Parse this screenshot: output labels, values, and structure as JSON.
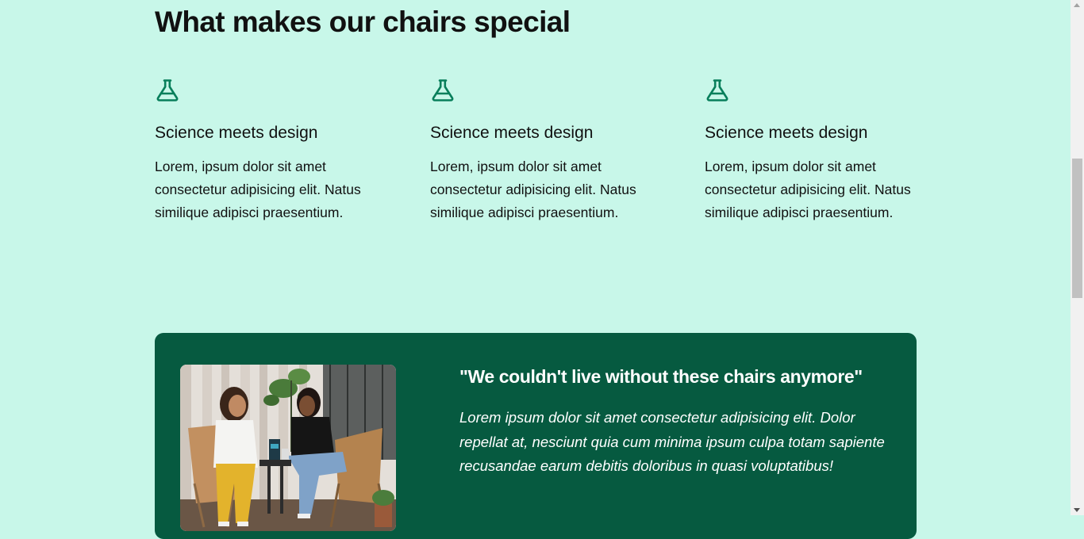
{
  "section": {
    "heading": "What makes our chairs special"
  },
  "features": [
    {
      "icon": "flask-icon",
      "title": "Science meets design",
      "text": "Lorem, ipsum dolor sit amet consectetur adipisicing elit. Natus similique adipisci praesentium."
    },
    {
      "icon": "flask-icon",
      "title": "Science meets design",
      "text": "Lorem, ipsum dolor sit amet consectetur adipisicing elit. Natus similique adipisci praesentium."
    },
    {
      "icon": "flask-icon",
      "title": "Science meets design",
      "text": "Lorem, ipsum dolor sit amet consectetur adipisicing elit. Natus similique adipisci praesentium."
    }
  ],
  "testimonial": {
    "quote": "\"We couldn't live without these chairs anymore\"",
    "body": "Lorem ipsum dolor sit amet consectetur adipisicing elit. Dolor repellat at, nesciunt quia cum minima ipsum culpa totam sapiente recusandae earum debitis doloribus in quasi voluptatibus!"
  },
  "colors": {
    "page_background": "#c8f7e9",
    "accent": "#087f5b",
    "testimonial_background": "#065a40",
    "text": "#111111"
  }
}
